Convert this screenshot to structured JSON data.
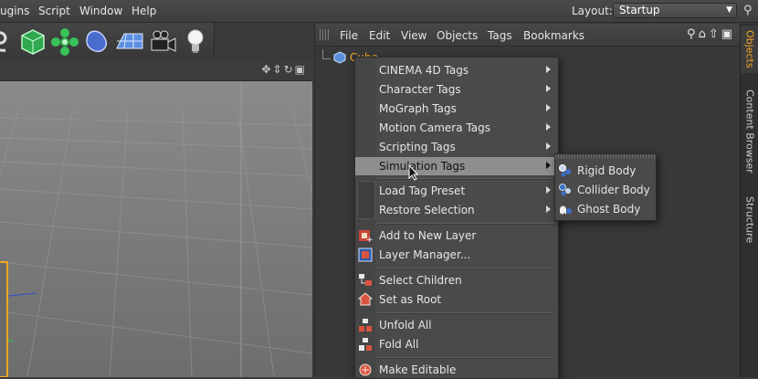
{
  "menubar": {
    "items": [
      "ugins",
      "Script",
      "Window",
      "Help"
    ],
    "layout_label": "Layout:",
    "layout_value": "Startup"
  },
  "object_manager": {
    "menu": [
      "File",
      "Edit",
      "View",
      "Objects",
      "Tags",
      "Bookmarks"
    ],
    "object_name": "Cube"
  },
  "side_tabs": [
    "Objects",
    "Content Browser",
    "Structure"
  ],
  "context_menu": {
    "items": [
      "CINEMA 4D Tags",
      "Character Tags",
      "MoGraph Tags",
      "Motion Camera Tags",
      "Scripting Tags",
      "Simulation Tags",
      "Load Tag Preset",
      "Restore Selection",
      "Add to New Layer",
      "Layer Manager...",
      "Select Children",
      "Set as Root",
      "Unfold All",
      "Fold All",
      "Make Editable"
    ]
  },
  "sub_menu": {
    "items": [
      "Rigid Body",
      "Collider Body",
      "Ghost Body"
    ]
  },
  "colors": {
    "accent": "#f5a623",
    "highlight": "#8e8e8e"
  }
}
